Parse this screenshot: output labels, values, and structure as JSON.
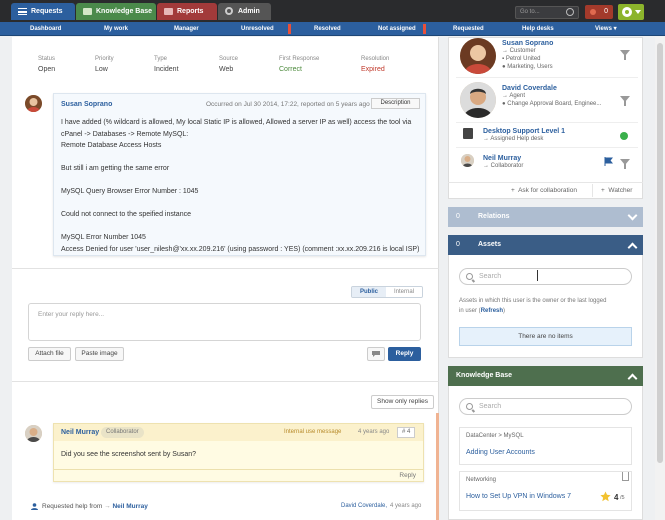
{
  "topnav": {
    "tabs": [
      {
        "label": "Requests",
        "color": "#2c5f9e"
      },
      {
        "label": "Knowledge Base",
        "color": "#4b8a4b"
      },
      {
        "label": "Reports",
        "color": "#a23a3a"
      },
      {
        "label": "Admin",
        "color": "#555555"
      }
    ],
    "goto_placeholder": "Go to...",
    "notifications": "0"
  },
  "subnav": {
    "items": [
      "Dashboard",
      "My work",
      "Manager",
      "Unresolved",
      "Resolved",
      "Not assigned",
      "Requested",
      "Help desks",
      "Views"
    ]
  },
  "ticket": {
    "status_label": "Status",
    "status": "Open",
    "priority_label": "Priority",
    "priority": "Low",
    "type_label": "Type",
    "type": "Incident",
    "source_label": "Source",
    "source": "Web",
    "first_response_label": "First Response",
    "first_response": "Correct",
    "resolution_label": "Resolution",
    "resolution": "Expired"
  },
  "description": {
    "author": "Susan Soprano",
    "meta": "Occurred on Jul 30 2014, 17:22, reported on 5 years ago",
    "button": "Description",
    "lines": [
      "I have added (% wildcard is allowed, My local Static IP is allowed, Allowed a server IP as well) access the tool via",
      "cPanel -> Databases -> Remote MySQL:",
      "Remote Database Access Hosts",
      "",
      "But still i am getting the same error",
      "",
      "MySQL Query Browser Error Number : 1045",
      "",
      "Could not connect to the speified instance",
      "",
      "MySQL Error Number 1045",
      "Access Denied for user 'user_nilesh@'xx.xx.209.216' (using password : YES) (comment :xx.xx.209.216 is local ISP)"
    ]
  },
  "reply": {
    "tab_public": "Public",
    "tab_internal": "Internal",
    "placeholder": "Enter your reply here...",
    "attach": "Attach file",
    "paste": "Paste image",
    "send": "Reply"
  },
  "show_only_replies": "Show only replies",
  "internal_comment": {
    "author": "Neil Murray",
    "role": "Collaborator",
    "tag": "Internal use message",
    "time": "4 years ago",
    "number": "# 4",
    "text": "Did you see the screenshot sent by Susan?",
    "reply": "Reply"
  },
  "requested_help": {
    "prefix": "Requested help from",
    "to": "Neil Murray",
    "by": "David Coverdale,",
    "time": "4 years ago"
  },
  "people": [
    {
      "name": "Susan Soprano",
      "role": "Customer",
      "org": "Petrol United",
      "groups": "Marketing, Users"
    },
    {
      "name": "David Coverdale",
      "role": "Agent",
      "groups": "Change Approval Board, Enginee..."
    },
    {
      "name": "Desktop Support Level 1",
      "role": "Assigned Help desk"
    },
    {
      "name": "Neil Murray",
      "role": "Collaborator"
    }
  ],
  "people_actions": {
    "collab": "Ask for collaboration",
    "watcher": "Watcher"
  },
  "relations": {
    "count": "0",
    "label": "Relations"
  },
  "assets": {
    "count": "0",
    "label": "Assets",
    "search_placeholder": "Search",
    "note_line1": "Assets in which this user is the owner or the last logged",
    "note_line2_pre": "in user (",
    "note_link": "Refresh",
    "note_line2_post": ")",
    "empty": "There are no items"
  },
  "knowledge_base": {
    "label": "Knowledge Base",
    "search_placeholder": "Search",
    "articles": [
      {
        "path": "DataCenter > MySQL",
        "title": "Adding User Accounts"
      },
      {
        "path": "Networking",
        "title": "How to Set Up VPN in Windows 7",
        "rating": "4",
        "rating_of": "/5"
      }
    ]
  }
}
